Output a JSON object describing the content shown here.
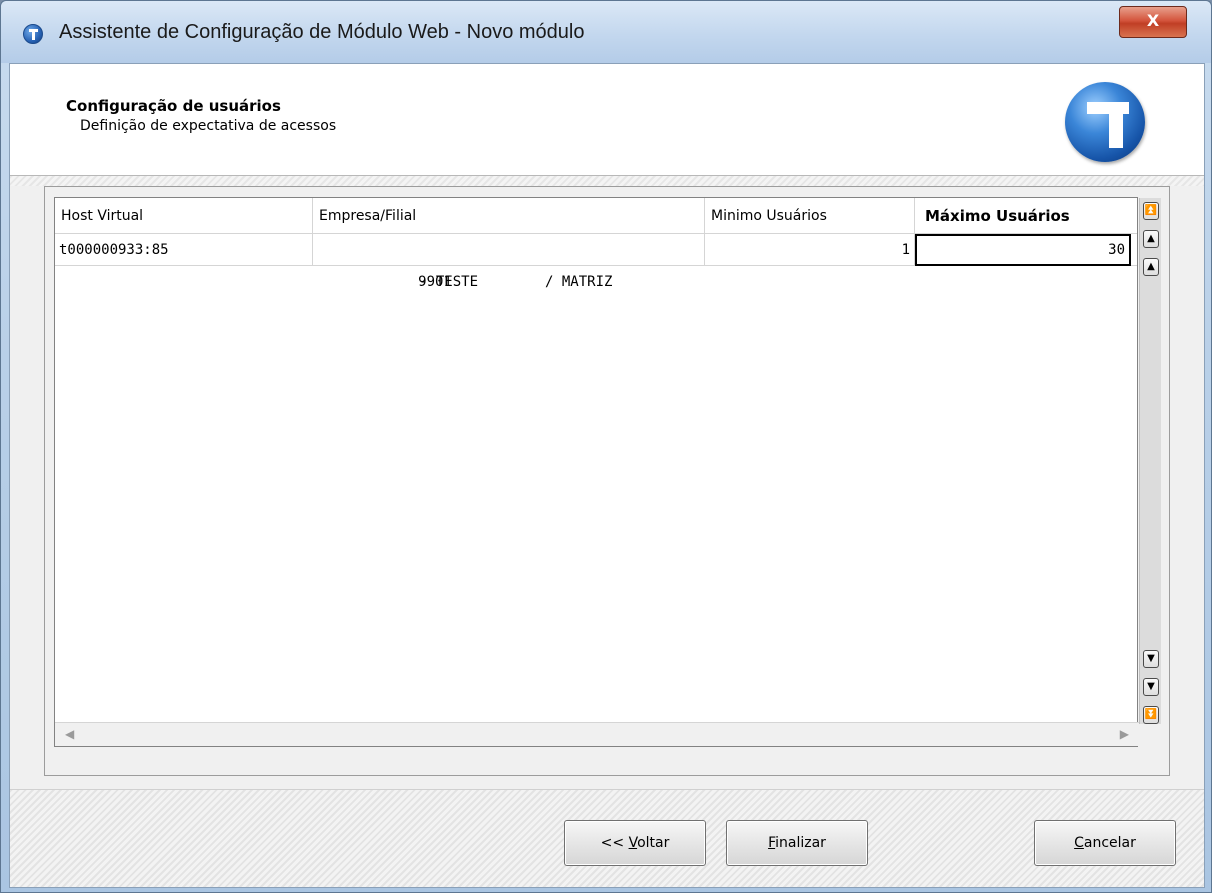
{
  "window": {
    "title": "Assistente de Configuração de Módulo Web - Novo módulo",
    "close_label": "X"
  },
  "header": {
    "title": "Configuração de usuários",
    "subtitle": "Definição de expectativa de acessos"
  },
  "grid": {
    "columns": [
      "Host Virtual",
      "Empresa/Filial",
      "Minimo Usuários",
      "Máximo Usuários"
    ],
    "rows": [
      {
        "host": "t000000933:85",
        "empresa_code": "9901",
        "empresa_name": "- TESTE",
        "filial": "/ MATRIZ",
        "min": "1",
        "max": "30"
      }
    ],
    "scroll_left": "◀",
    "scroll_right": "▶",
    "vbtn_top": "⏫",
    "vbtn_pgup": "▲",
    "vbtn_up": "▲",
    "vbtn_down": "▼",
    "vbtn_pgdn": "▼",
    "vbtn_bottom": "⏬"
  },
  "buttons": {
    "back_prefix": "<< ",
    "back_key": "V",
    "back_rest": "oltar",
    "finish_key": "F",
    "finish_rest": "inalizar",
    "cancel_key": "C",
    "cancel_rest": "ancelar"
  }
}
